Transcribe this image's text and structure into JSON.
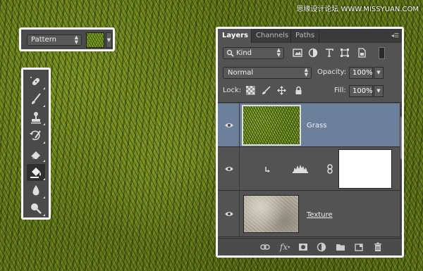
{
  "watermark": "思缘设计论坛 WWW.MISSYUAN.COM",
  "options_bar": {
    "pattern_select": "Pattern",
    "pattern_swatch_icon": "pattern-swatch",
    "dropdown_icon": "chevron-down-icon"
  },
  "tools": [
    {
      "name": "spot-healing-brush-icon",
      "active": false
    },
    {
      "name": "brush-icon",
      "active": false
    },
    {
      "name": "clone-stamp-icon",
      "active": false
    },
    {
      "name": "history-brush-icon",
      "active": false
    },
    {
      "name": "eraser-icon",
      "active": false
    },
    {
      "name": "paint-bucket-icon",
      "active": true
    },
    {
      "name": "blur-icon",
      "active": false
    },
    {
      "name": "dodge-icon",
      "active": false
    }
  ],
  "layers_panel": {
    "tabs": [
      "Layers",
      "Channels",
      "Paths"
    ],
    "active_tab": "Layers",
    "filter_kind": "Kind",
    "blend_mode": "Normal",
    "opacity_label": "Opacity:",
    "opacity_value": "100%",
    "lock_label": "Lock:",
    "fill_label": "Fill:",
    "fill_value": "100%",
    "layers": [
      {
        "name": "Grass",
        "type": "pattern",
        "visible": true,
        "selected": true
      },
      {
        "name": "",
        "type": "adjustment",
        "visible": true,
        "selected": false
      },
      {
        "name": "Texture",
        "type": "image",
        "visible": true,
        "selected": false
      }
    ],
    "selected_layer_color": "#6c809c"
  }
}
